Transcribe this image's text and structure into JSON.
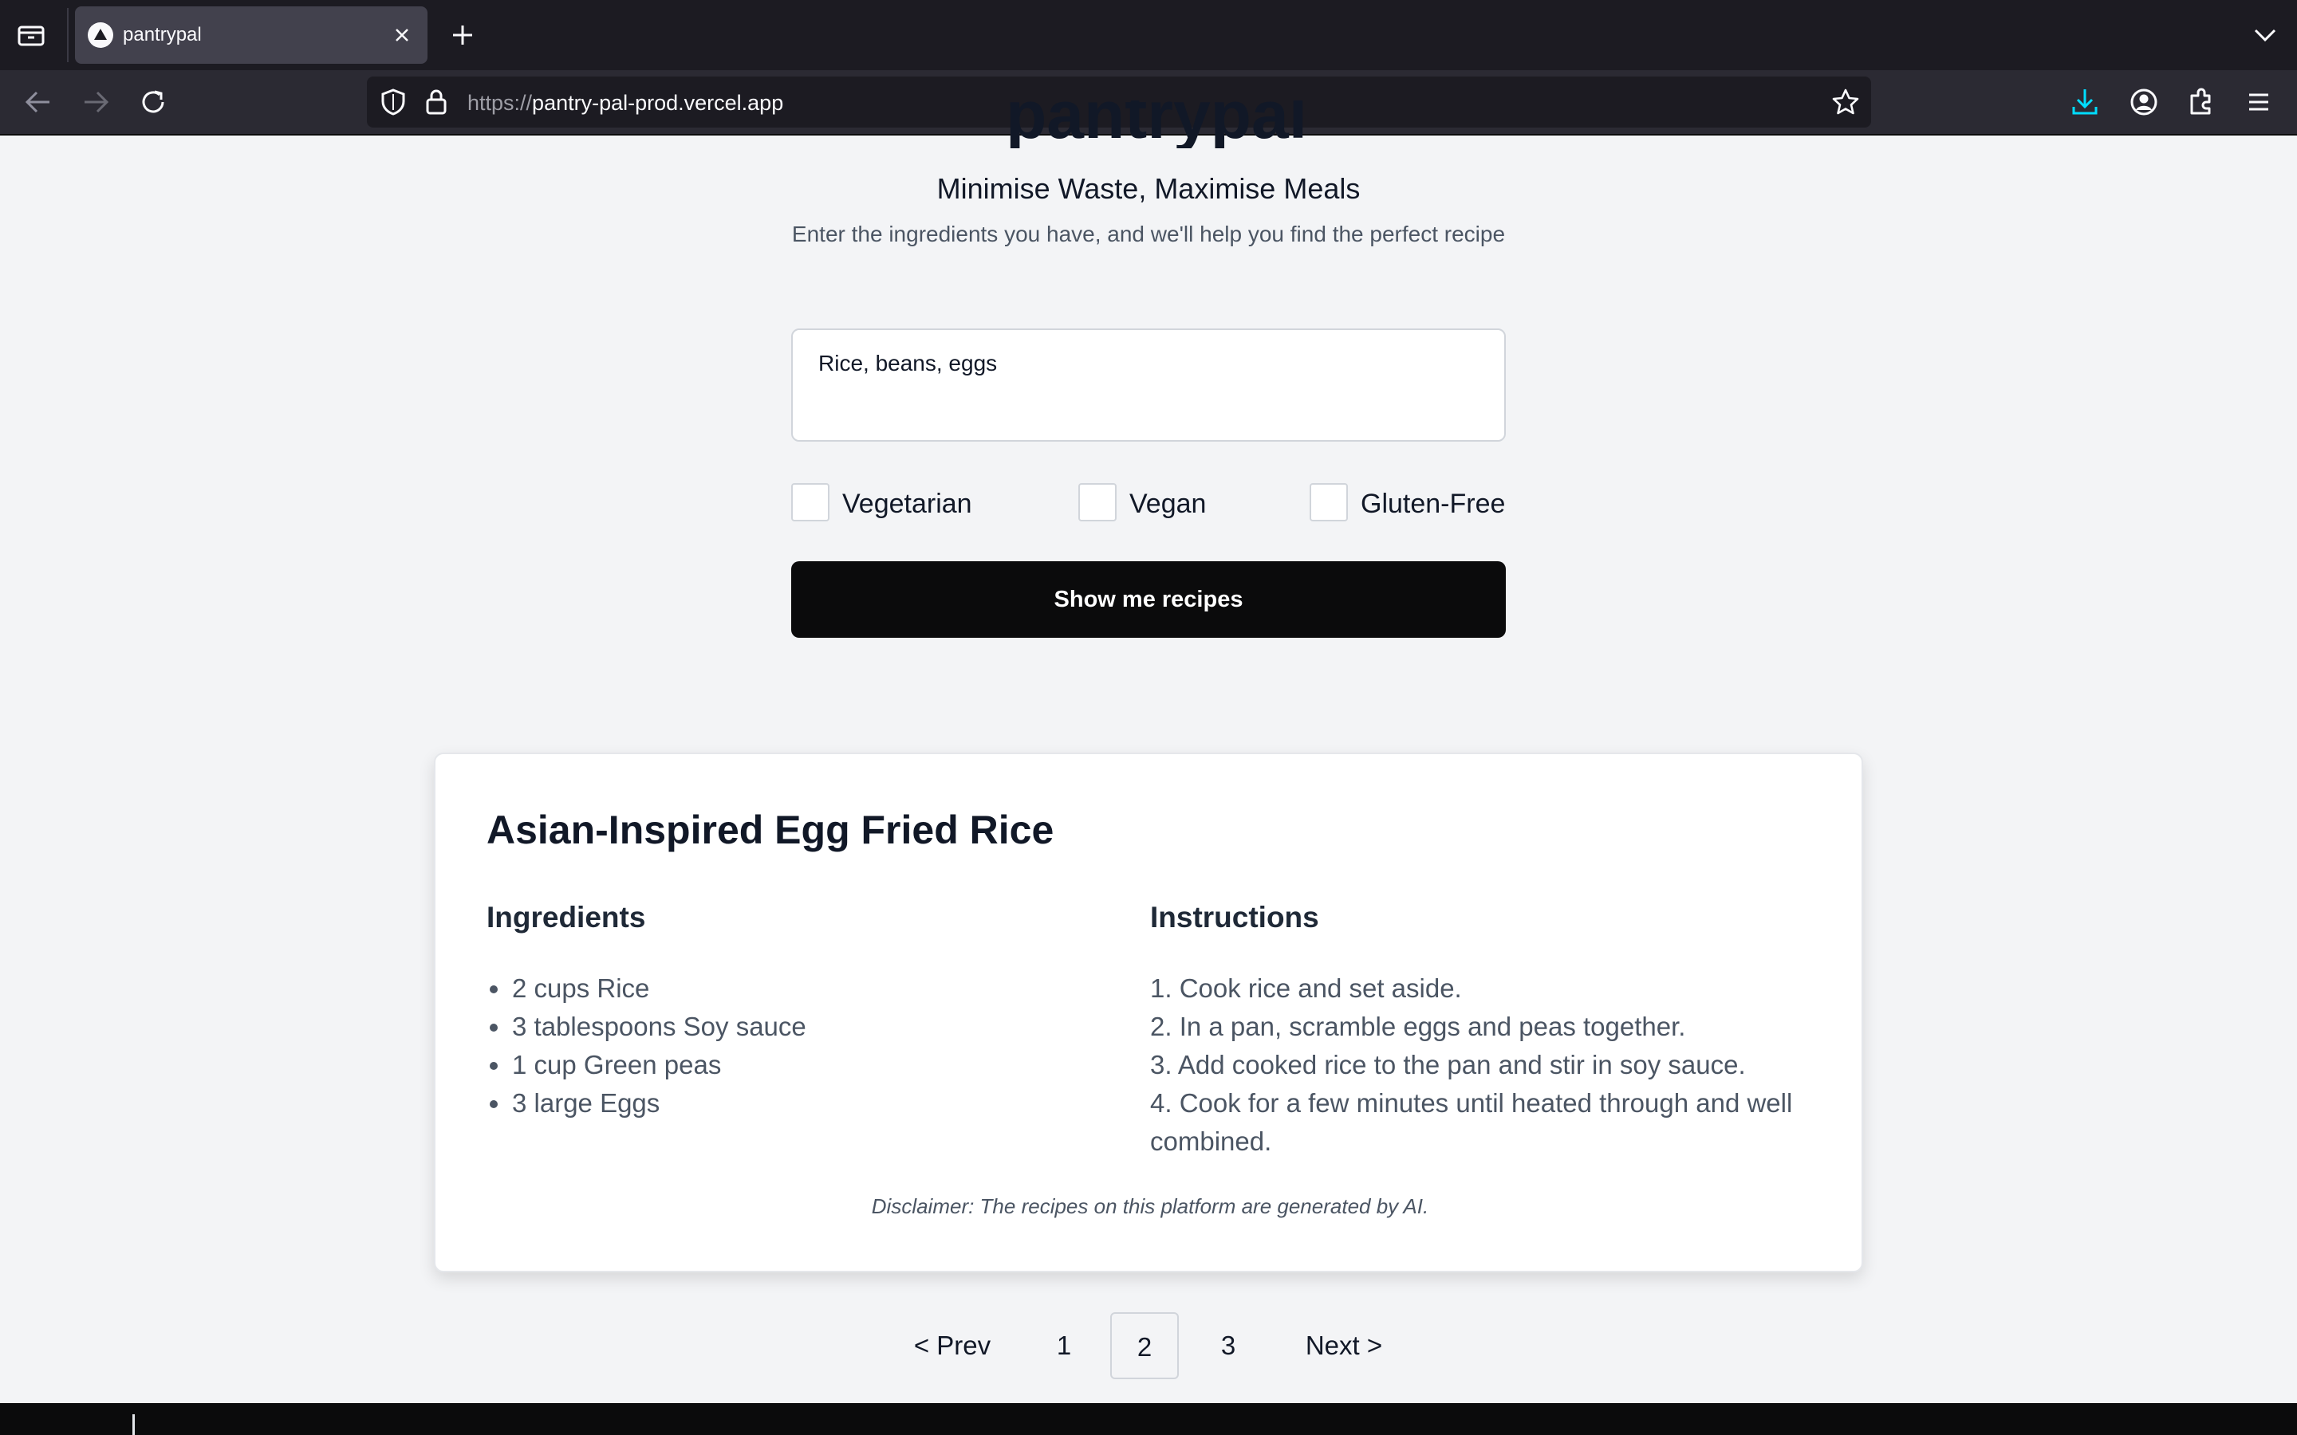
{
  "browser": {
    "tab_title": "pantrypal",
    "url_protocol": "https://",
    "url_host": "pantry-pal-prod.vercel.app"
  },
  "hero": {
    "title": "pantrypal",
    "tagline": "Minimise Waste, Maximise Meals",
    "subtitle": "Enter the ingredients you have, and we'll help you find the perfect recipe"
  },
  "form": {
    "ingredients_value": "Rice, beans, eggs",
    "filters": [
      {
        "label": "Vegetarian",
        "checked": false
      },
      {
        "label": "Vegan",
        "checked": false
      },
      {
        "label": "Gluten-Free",
        "checked": false
      }
    ],
    "submit_label": "Show me recipes"
  },
  "recipe": {
    "title": "Asian-Inspired Egg Fried Rice",
    "ingredients_heading": "Ingredients",
    "instructions_heading": "Instructions",
    "ingredients": [
      "2 cups Rice",
      "3 tablespoons Soy sauce",
      "1 cup Green peas",
      "3 large Eggs"
    ],
    "instructions": [
      "1. Cook rice and set aside.",
      "2. In a pan, scramble eggs and peas together.",
      "3. Add cooked rice to the pan and stir in soy sauce.",
      "4. Cook for a few minutes until heated through and well combined."
    ],
    "disclaimer": "Disclaimer: The recipes on this platform are generated by AI."
  },
  "pagination": {
    "prev_label": "< Prev",
    "next_label": "Next >",
    "pages": [
      "1",
      "2",
      "3"
    ],
    "current_page": "2"
  },
  "colors": {
    "page_background": "#f3f4f6",
    "button_background": "#0b0b0c",
    "browser_chrome": "#1c1b22",
    "download_icon_accent": "#00ddff"
  },
  "icons": {
    "tab_list": "folder-tabs-icon",
    "tab_close": "close-icon",
    "new_tab": "plus-icon",
    "tab_overflow": "chevron-down-icon",
    "back": "arrow-left-icon",
    "forward": "arrow-right-icon",
    "reload": "reload-icon",
    "tracking_protection": "shield-icon",
    "site_security": "lock-icon",
    "bookmark": "star-icon",
    "downloads": "download-icon",
    "account": "account-icon",
    "extensions": "puzzle-icon",
    "menu": "hamburger-menu-icon"
  }
}
